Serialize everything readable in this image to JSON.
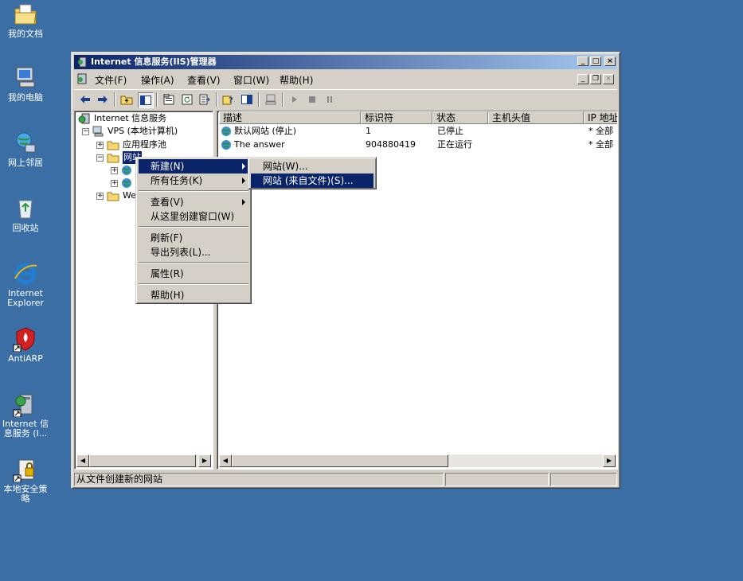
{
  "desktop": {
    "icons": [
      {
        "label": "我的文档",
        "icon": "my-documents-icon"
      },
      {
        "label": "我的电脑",
        "icon": "my-computer-icon"
      },
      {
        "label": "网上邻居",
        "icon": "network-places-icon"
      },
      {
        "label": "回收站",
        "icon": "recycle-bin-icon"
      },
      {
        "label": "Internet Explorer",
        "icon": "internet-explorer-icon"
      },
      {
        "label": "AntiARP",
        "icon": "antiarp-icon"
      },
      {
        "label": "Internet 信息服务 (I...",
        "icon": "iis-shortcut-icon"
      },
      {
        "label": "本地安全策略",
        "icon": "security-policy-icon"
      }
    ]
  },
  "window": {
    "title": "Internet 信息服务(IIS)管理器",
    "controls": {
      "minimize": "_",
      "maximize": "□",
      "close": "×"
    }
  },
  "menubar": {
    "items": [
      "文件(F)",
      "操作(A)",
      "查看(V)",
      "窗口(W)",
      "帮助(H)"
    ]
  },
  "tree": {
    "root": "Internet 信息服务",
    "computer": "VPS (本地计算机)",
    "app_pools": "应用程序池",
    "websites": "网站",
    "web_ext_partial": "We"
  },
  "list": {
    "columns": [
      "描述",
      "标识符",
      "状态",
      "主机头值",
      "IP 地址"
    ],
    "rows": [
      {
        "desc": "默认网站 (停止)",
        "id": "1",
        "status": "已停止",
        "host": "",
        "ip": "* 全部"
      },
      {
        "desc": "The answer",
        "id": "904880419",
        "status": "正在运行",
        "host": "",
        "ip": "* 全部"
      }
    ]
  },
  "context_menu": {
    "items": [
      {
        "label": "新建(N)",
        "submenu": true,
        "selected": true
      },
      {
        "label": "所有任务(K)",
        "submenu": true
      },
      {
        "label": "查看(V)",
        "submenu": true
      },
      {
        "label": "从这里创建窗口(W)"
      },
      {
        "label": "刷新(F)"
      },
      {
        "label": "导出列表(L)..."
      },
      {
        "label": "属性(R)"
      },
      {
        "label": "帮助(H)"
      }
    ]
  },
  "submenu": {
    "items": [
      {
        "label": "网站(W)..."
      },
      {
        "label": "网站 (来自文件)(S)...",
        "selected": true
      }
    ]
  },
  "statusbar": {
    "text": "从文件创建新的网站"
  },
  "colors": {
    "desktop": "#3a6ea5",
    "title_active": "#0a246a",
    "face": "#d4d0c8",
    "highlight": "#0a246a"
  }
}
